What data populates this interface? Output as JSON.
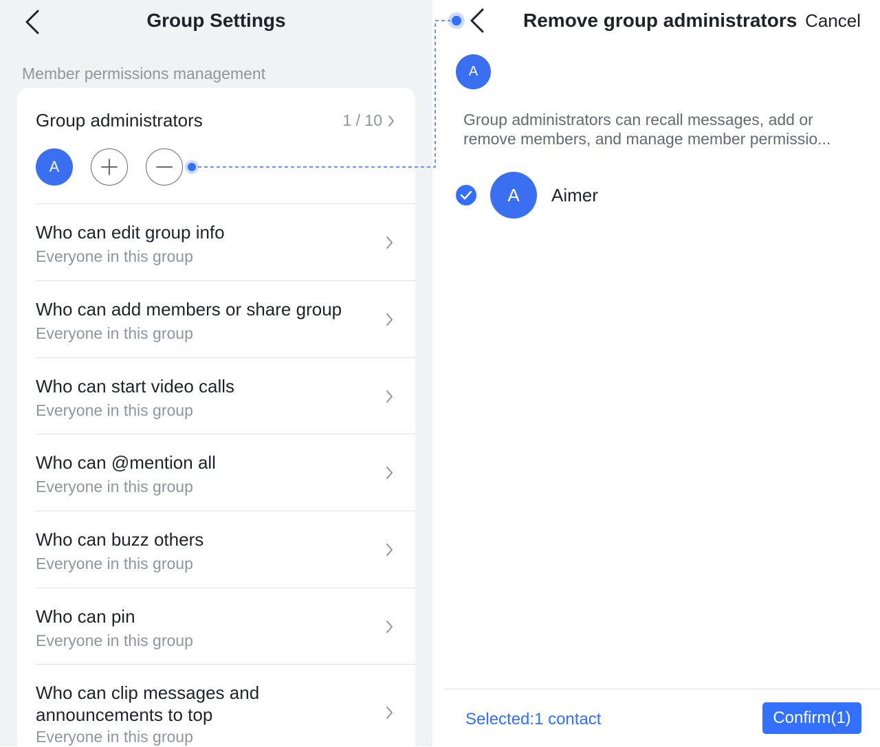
{
  "left": {
    "header": {
      "title": "Group Settings"
    },
    "section_label": "Member permissions management",
    "admins": {
      "title": "Group administrators",
      "count": "1 / 10",
      "avatar_initial": "A"
    },
    "permissions": [
      {
        "title": "Who can edit group info",
        "subtitle": "Everyone in this group"
      },
      {
        "title": "Who can add members or share group",
        "subtitle": "Everyone in this group"
      },
      {
        "title": "Who can start video calls",
        "subtitle": "Everyone in this group"
      },
      {
        "title": "Who can @mention all",
        "subtitle": "Everyone in this group"
      },
      {
        "title": "Who can buzz others",
        "subtitle": "Everyone in this group"
      },
      {
        "title": "Who can pin",
        "subtitle": "Everyone in this group"
      },
      {
        "title": "Who can clip messages and\nannouncements to top",
        "subtitle": "Everyone in this group"
      }
    ]
  },
  "right": {
    "header": {
      "title": "Remove group administrators",
      "cancel": "Cancel"
    },
    "selected_avatar_initial": "A",
    "description": "Group administrators can recall messages, add or remove members, and manage member permissio...",
    "member": {
      "initial": "A",
      "name": "Aimer"
    },
    "footer": {
      "selected": "Selected:1 contact",
      "confirm": "Confirm(1)"
    }
  },
  "colors": {
    "accent": "#3370ff",
    "avatar": "#3a6ff1",
    "pane_bg": "#f1f2f4"
  }
}
